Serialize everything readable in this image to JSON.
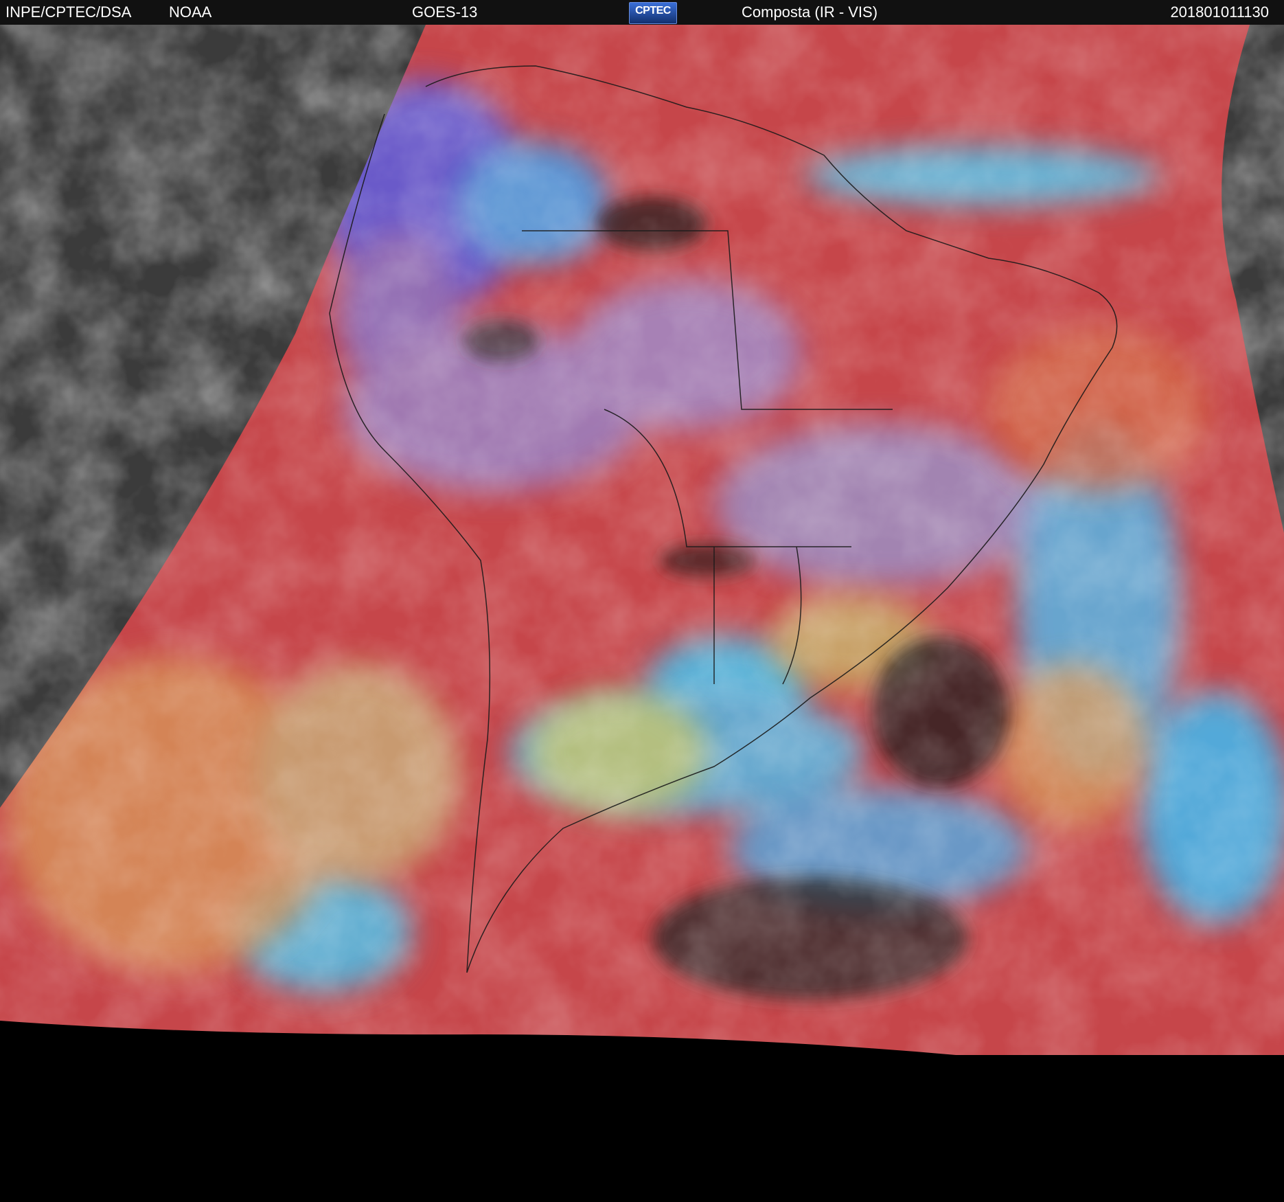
{
  "header": {
    "agency": "INPE/CPTEC/DSA",
    "partner": "NOAA",
    "satellite": "GOES-13",
    "logo_text": "CPTEC",
    "product": "Composta (IR - VIS)",
    "timestamp": "201801011130"
  },
  "colors": {
    "header_bg": "#111111",
    "header_text": "#ffffff",
    "night_side": "#3a3a3a",
    "composite_warm": "#c6464a",
    "composite_cold_cloud": "#3fb7ea",
    "composite_mid_cloud": "#a7c36a",
    "outside_disk": "#000000",
    "borders": "#1a1a1a"
  }
}
